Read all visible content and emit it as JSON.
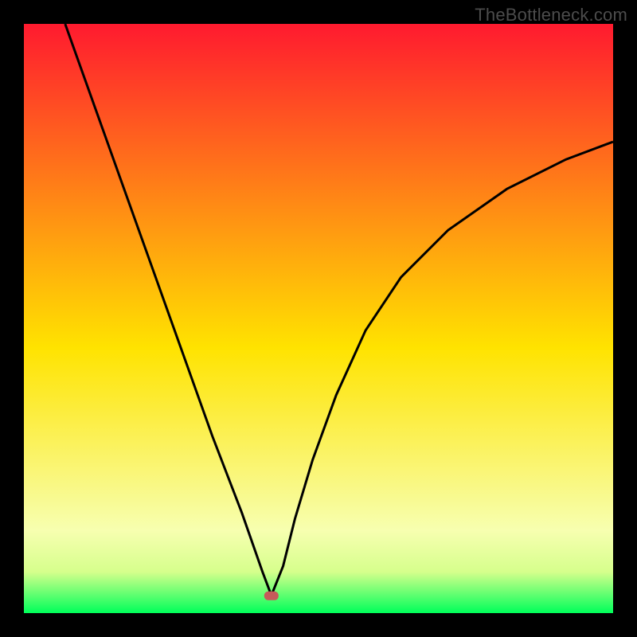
{
  "watermark": "TheBottleneck.com",
  "accent_colors": {
    "top": "#ff1a2f",
    "mid": "#ffe300",
    "bottom": "#00ff5a",
    "marker": "#c65a5a",
    "curve": "#000000",
    "frame": "#000000"
  },
  "chart_data": {
    "type": "line",
    "title": "",
    "xlabel": "",
    "ylabel": "",
    "xlim": [
      0,
      100
    ],
    "ylim": [
      0,
      100
    ],
    "marker_x": 42.0,
    "marker_y": 3.0,
    "series": [
      {
        "name": "left_branch",
        "x": [
          7.0,
          12.0,
          17.0,
          22.0,
          27.0,
          32.0,
          37.0,
          40.5,
          42.0
        ],
        "y": [
          100.0,
          86.0,
          72.0,
          58.0,
          44.0,
          30.0,
          17.0,
          7.0,
          3.0
        ]
      },
      {
        "name": "right_branch",
        "x": [
          42.0,
          44.0,
          46.0,
          49.0,
          53.0,
          58.0,
          64.0,
          72.0,
          82.0,
          92.0,
          100.0
        ],
        "y": [
          3.0,
          8.0,
          16.0,
          26.0,
          37.0,
          48.0,
          57.0,
          65.0,
          72.0,
          77.0,
          80.0
        ]
      }
    ]
  }
}
